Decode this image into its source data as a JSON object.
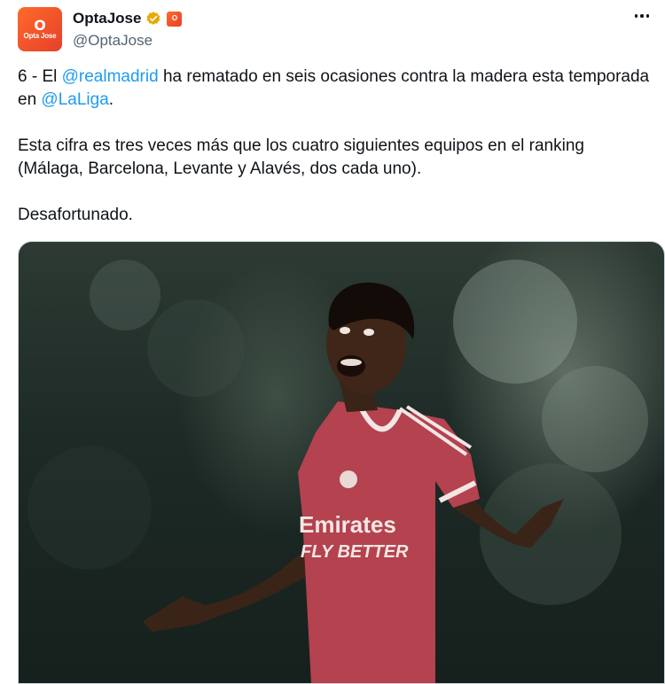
{
  "author": {
    "display_name": "OptaJose",
    "handle": "@OptaJose",
    "avatar_text": "Opta Jose",
    "avatar_icon_glyph": "O",
    "affiliate_badge_glyph": "O",
    "verified_color": "#f4b400"
  },
  "tweet": {
    "para1_prefix": "6 - El ",
    "mention_1": "@realmadrid",
    "para1_mid": " ha rematado en seis ocasiones contra la madera esta temporada en ",
    "mention_2": "@LaLiga",
    "para1_suffix": ".",
    "para2": "Esta cifra es tres veces más que los cuatro siguientes equipos en el ranking (Málaga, Barcelona, Levante y Alavés, dos cada uno).",
    "para3": "Desafortunado."
  },
  "media": {
    "description_alt": "football-player-photo",
    "shirt_sponsor_line1": "Emirates",
    "shirt_sponsor_line2": "FLY BETTER",
    "shirt_color": "#b4424f"
  },
  "colors": {
    "link": "#1d9bf0",
    "text": "#0f1419",
    "muted": "#536471",
    "brand": "#ff5a2a"
  },
  "icons": {
    "more": "more-options-icon",
    "verified": "verified-badge-icon",
    "affiliate": "affiliate-badge-icon"
  }
}
